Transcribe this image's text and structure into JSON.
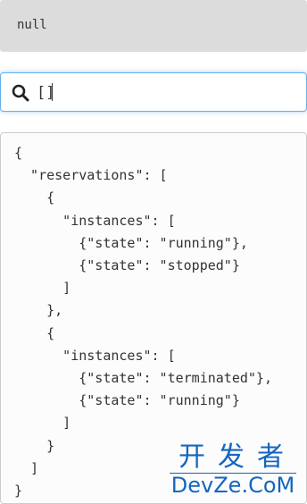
{
  "result": {
    "text": "null"
  },
  "query": {
    "value": "[]",
    "icon": "search-icon"
  },
  "input_json": {
    "text": "{\n  \"reservations\": [\n    {\n      \"instances\": [\n        {\"state\": \"running\"},\n        {\"state\": \"stopped\"}\n      ]\n    },\n    {\n      \"instances\": [\n        {\"state\": \"terminated\"},\n        {\"state\": \"running\"}\n      ]\n    }\n  ]\n}"
  },
  "watermark": {
    "chinese": "开发者",
    "english": "DevZe.CoM"
  },
  "colors": {
    "result_bg": "#dcdcdc",
    "focus_border": "#66afe9",
    "watermark": "#1565c0"
  }
}
